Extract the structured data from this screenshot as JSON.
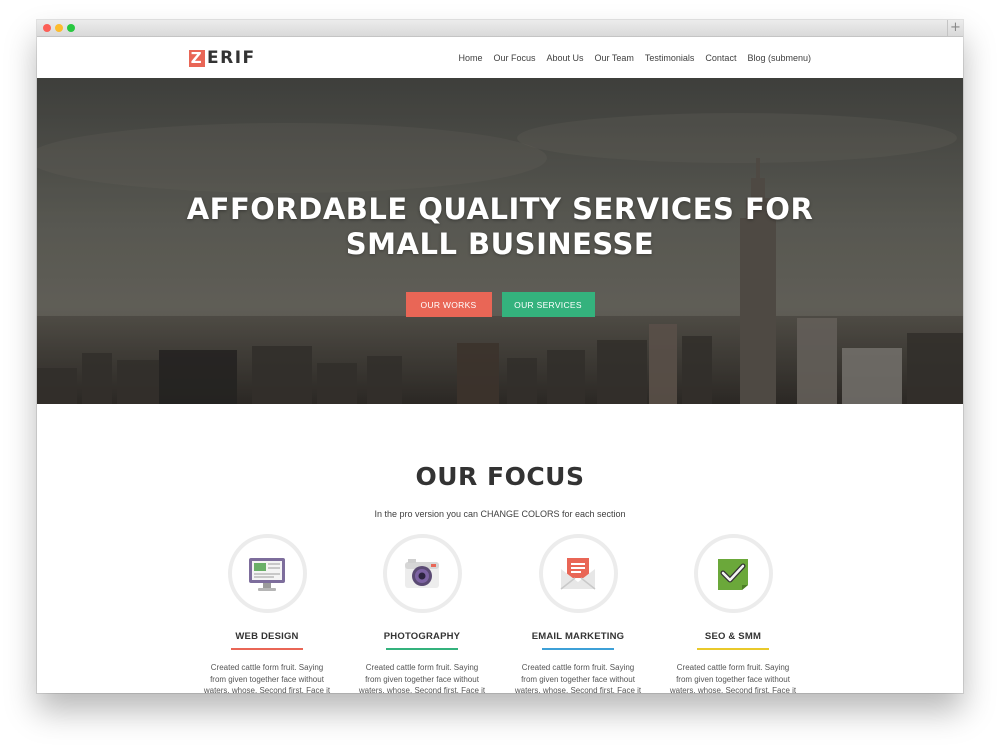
{
  "browser": {
    "new_tab_symbol": "+"
  },
  "brand": {
    "logo_initial": "Z",
    "logo_rest": "ERIF",
    "accent": "#e96656"
  },
  "nav": {
    "items": [
      "Home",
      "Our Focus",
      "About Us",
      "Our Team",
      "Testimonials",
      "Contact",
      "Blog (submenu)"
    ]
  },
  "hero": {
    "title_line1": "AFFORDABLE QUALITY SERVICES FOR",
    "title_line2": "SMALL BUSINESSE",
    "button_works": "OUR WORKS",
    "button_services": "OUR SERVICES",
    "button_works_color": "#e96656",
    "button_services_color": "#34b27d"
  },
  "focus": {
    "title": "OUR FOCUS",
    "subtitle": "In the pro version you can CHANGE COLORS for each section",
    "cards": [
      {
        "icon": "monitor-icon",
        "title": "WEB DESIGN",
        "line_color": "#e96656",
        "text": "Created cattle form fruit. Saying from given together face without waters, whose. Second first. Face it saw give"
      },
      {
        "icon": "camera-icon",
        "title": "PHOTOGRAPHY",
        "line_color": "#34b27d",
        "text": "Created cattle form fruit. Saying from given together face without waters, whose. Second first. Face it saw give"
      },
      {
        "icon": "envelope-icon",
        "title": "EMAIL MARKETING",
        "line_color": "#3ea0d7",
        "text": "Created cattle form fruit. Saying from given together face without waters, whose. Second first. Face it saw give"
      },
      {
        "icon": "checkmark-icon",
        "title": "SEO & SMM",
        "line_color": "#e9c92b",
        "text": "Created cattle form fruit. Saying from given together face without waters, whose. Second first. Face it saw give"
      }
    ]
  }
}
